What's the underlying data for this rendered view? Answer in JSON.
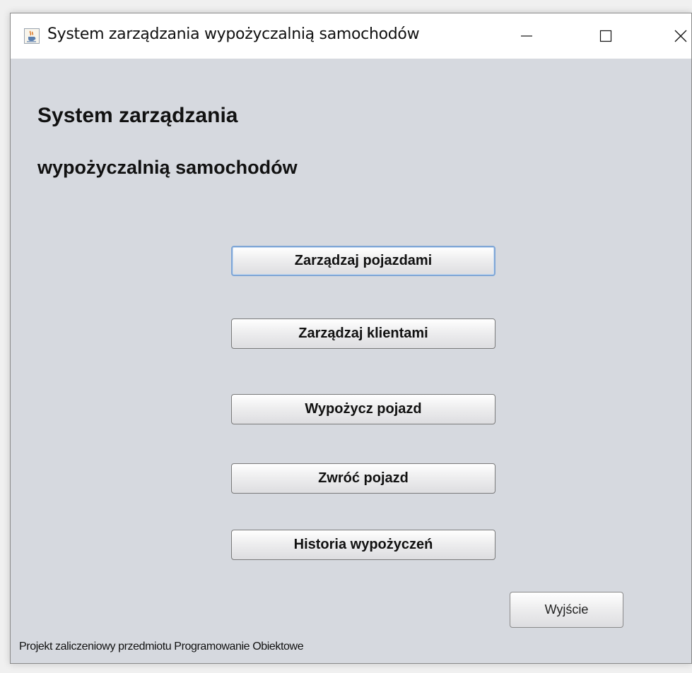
{
  "window": {
    "title": "System zarządzania wypożyczalnią samochodów",
    "controls": {
      "minimize_glyph": "minimize-icon",
      "maximize_glyph": "maximize-icon",
      "close_glyph": "close-icon"
    },
    "app_icon": "java-cup-icon"
  },
  "main": {
    "heading_line1": "System zarządzania",
    "heading_line2": "wypożyczalnią samochodów",
    "buttons": [
      {
        "label": "Zarządzaj pojazdami",
        "focused": true
      },
      {
        "label": "Zarządzaj klientami",
        "focused": false
      },
      {
        "label": "Wypożycz pojazd",
        "focused": false
      },
      {
        "label": "Zwróć pojazd",
        "focused": false
      },
      {
        "label": "Historia wypożyczeń",
        "focused": false
      }
    ],
    "exit_label": "Wyjście",
    "footer": "Projekt zaliczeniowy przedmiotu Programowanie Obiektowe"
  },
  "colors": {
    "panel_background": "#d6d9df",
    "titlebar_background": "#ffffff",
    "focus_border": "#7fa6d6"
  }
}
